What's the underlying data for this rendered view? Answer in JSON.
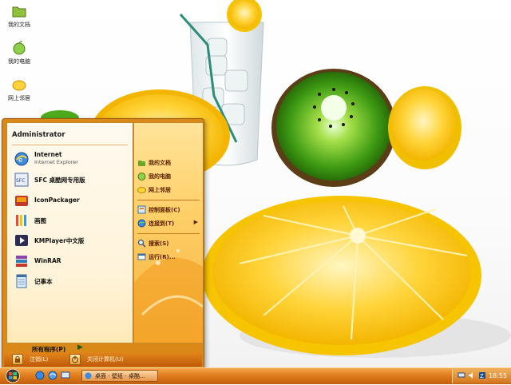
{
  "desktop": {
    "icons": [
      {
        "label": "我的文档"
      },
      {
        "label": "我的电脑"
      },
      {
        "label": "网上邻居"
      }
    ]
  },
  "start_menu": {
    "user_name": "Administrator",
    "programs": [
      {
        "title": "Internet",
        "subtitle": "Internet Explorer",
        "icon": "internet-explorer-icon"
      },
      {
        "title": "SFC 桌酷网专用版",
        "icon": "sfc-icon"
      },
      {
        "title": "IconPackager",
        "icon": "iconpackager-icon"
      },
      {
        "title": "画图",
        "icon": "paint-icon"
      },
      {
        "title": "KMPlayer中文版",
        "icon": "kmplayer-icon"
      },
      {
        "title": "WinRAR",
        "icon": "winrar-icon"
      },
      {
        "title": "记事本",
        "icon": "notepad-icon"
      }
    ],
    "all_programs": "所有程序(P)",
    "right_items": [
      {
        "label": "我的文档",
        "icon": "my-documents-icon"
      },
      {
        "label": "我的电脑",
        "icon": "my-computer-icon"
      },
      {
        "label": "网上邻居",
        "icon": "network-places-icon"
      },
      {
        "label": "控制面板(C)",
        "icon": "control-panel-icon"
      },
      {
        "label": "连接到(T)",
        "icon": "connect-to-icon"
      },
      {
        "label": "搜索(S)",
        "icon": "search-icon"
      },
      {
        "label": "运行(R)...",
        "icon": "run-icon"
      }
    ],
    "logoff": "注销(L)",
    "shutdown": "关闭计算机(U)"
  },
  "taskbar": {
    "task_button": "桌面 - 壁纸 - 桌酷...",
    "clock": "18:55"
  },
  "colors": {
    "menu_orange": "#d98918",
    "taskbar_orange": "#e07c1c",
    "right_pane_yellow": "#ffd06a"
  }
}
